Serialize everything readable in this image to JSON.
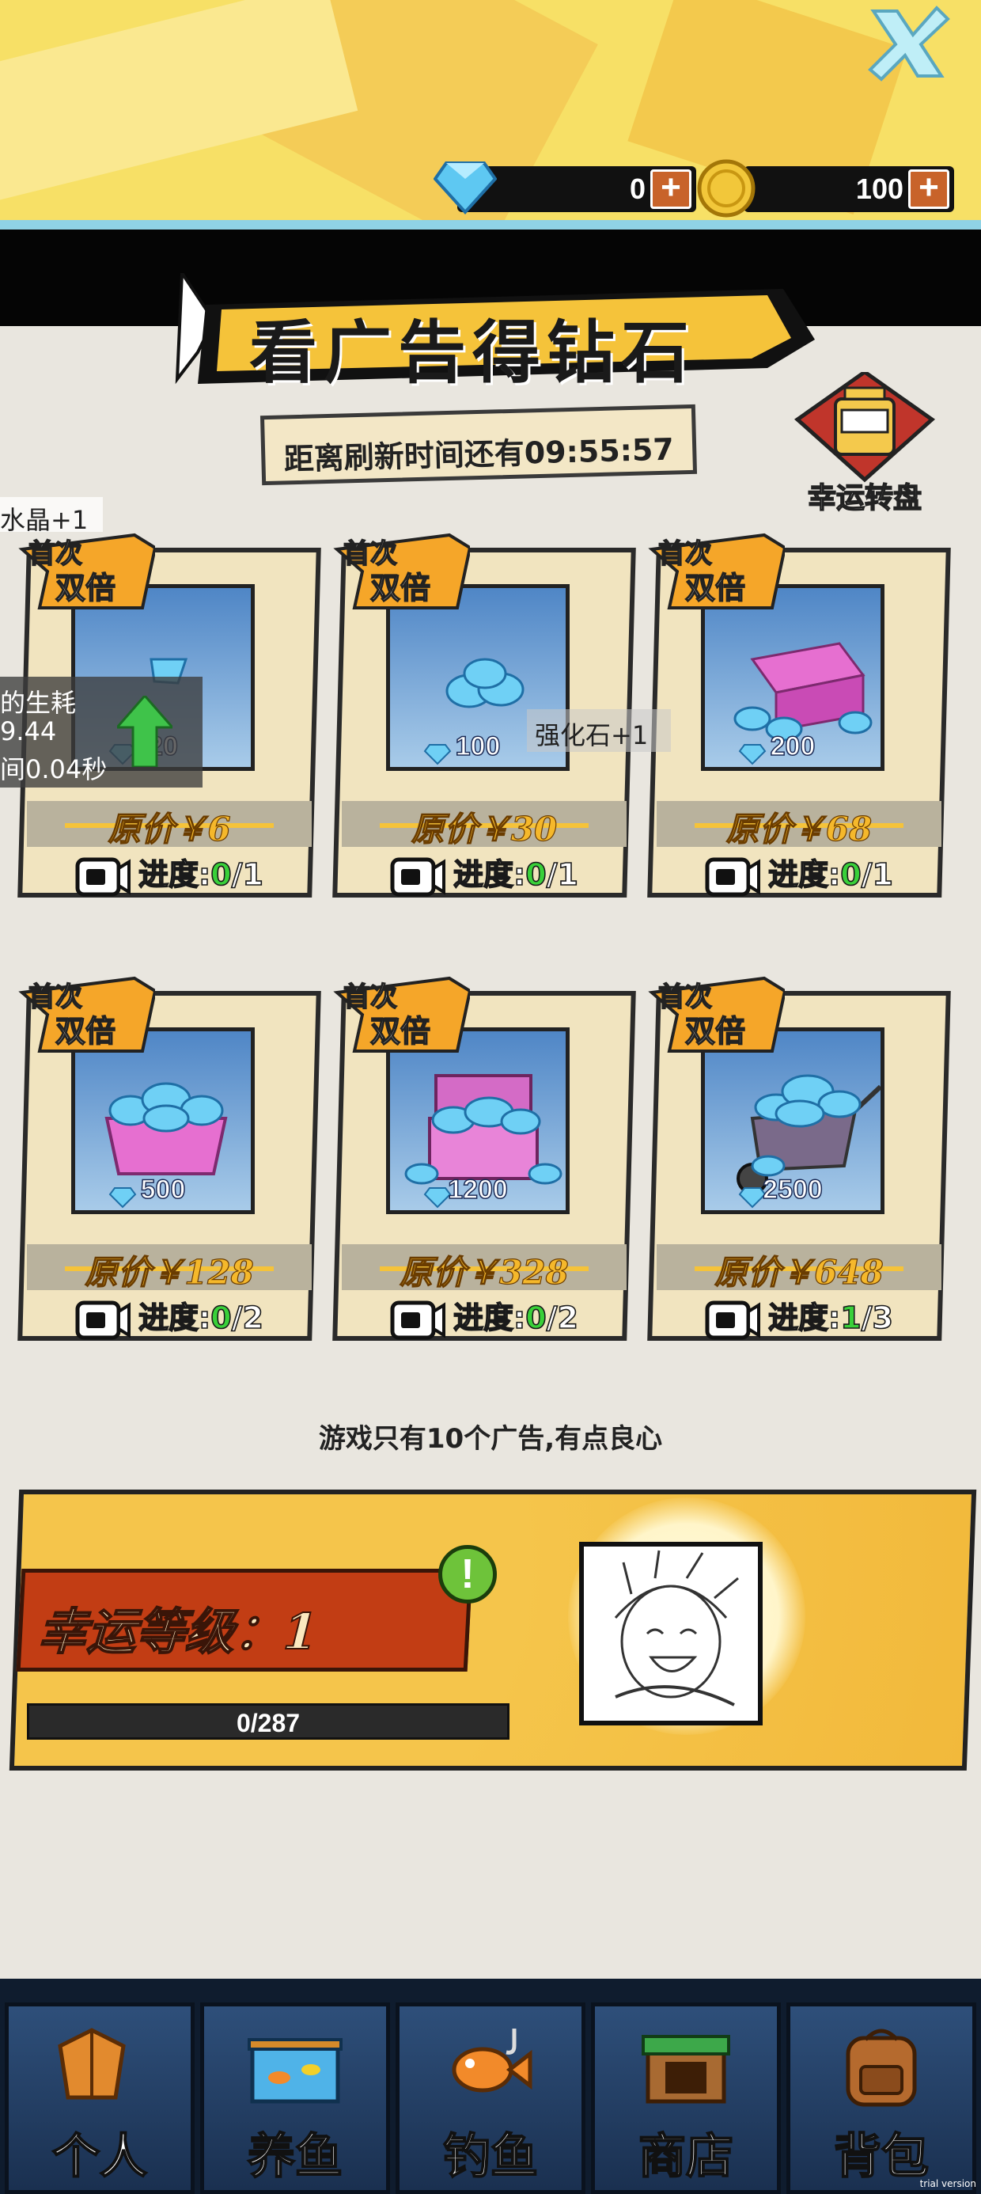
{
  "header": {
    "diamonds": "0",
    "coins": "100",
    "plus_label": "+",
    "close_label": "close"
  },
  "title": "看广告得钻石",
  "refresh_timer": "距离刷新时间还有09:55:57",
  "lucky_wheel_label": "幸运转盘",
  "overlays": {
    "crystal": "水晶+1",
    "tooltip_lines": [
      "的生耗",
      "9.44",
      "间0.04秒"
    ],
    "stone": "强化石+1"
  },
  "badge": {
    "line1": "首次",
    "line2": "双倍"
  },
  "progress_label": "进度:",
  "cards": [
    {
      "amount": "20",
      "price": "原价￥6",
      "current": "0",
      "total": "/1",
      "art": "small"
    },
    {
      "amount": "100",
      "price": "原价￥30",
      "current": "0",
      "total": "/1",
      "art": "pile"
    },
    {
      "amount": "200",
      "price": "原价￥68",
      "current": "0",
      "total": "/1",
      "art": "box"
    },
    {
      "amount": "500",
      "price": "原价￥128",
      "current": "0",
      "total": "/2",
      "art": "basket"
    },
    {
      "amount": "1200",
      "price": "原价￥328",
      "current": "0",
      "total": "/2",
      "art": "chest"
    },
    {
      "amount": "2500",
      "price": "原价￥648",
      "current": "1",
      "total": "/3",
      "art": "cart"
    }
  ],
  "ad_note": "游戏只有10个广告,有点良心",
  "luck": {
    "level_label": "幸运等级：1",
    "progress_text": "0/287",
    "progress_fraction": 0,
    "alert": "!"
  },
  "nav": [
    {
      "label": "个人",
      "icon": "jacket-icon"
    },
    {
      "label": "养鱼",
      "icon": "aquarium-icon"
    },
    {
      "label": "钓鱼",
      "icon": "fish-hook-icon"
    },
    {
      "label": "商店",
      "icon": "shop-crate-icon"
    },
    {
      "label": "背包",
      "icon": "backpack-icon"
    }
  ],
  "watermark": "trial version",
  "colors": {
    "accent": "#f7e066",
    "diamond": "#5ec8f2",
    "progress_current": "#39d039",
    "level_red": "#c23d14"
  }
}
